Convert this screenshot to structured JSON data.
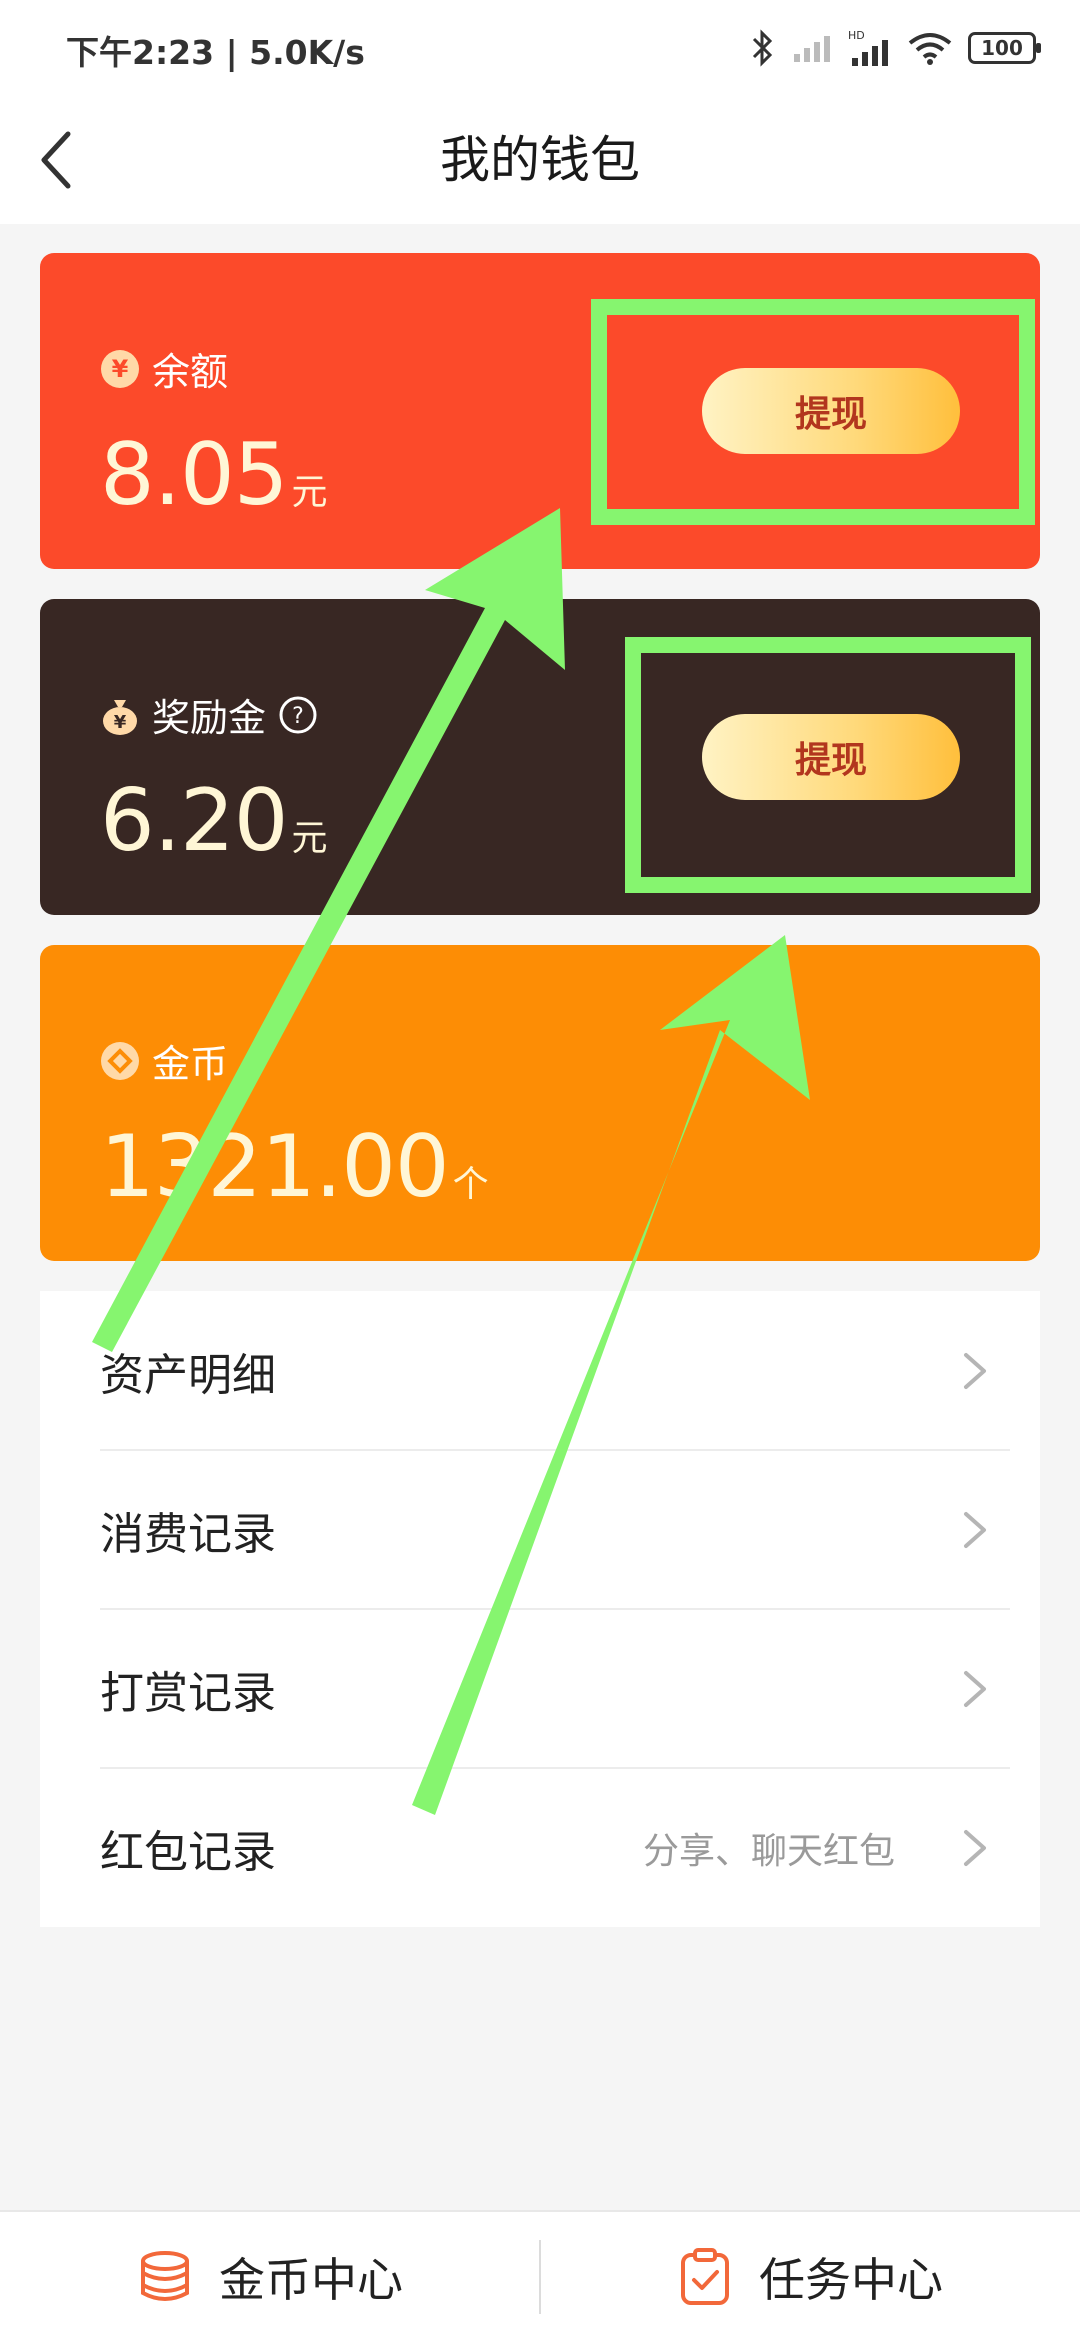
{
  "status_bar": {
    "time": "下午2:23 | 5.0K/s",
    "battery": "100",
    "network_badge": "HD"
  },
  "header": {
    "title": "我的钱包"
  },
  "cards": {
    "balance": {
      "label": "余额",
      "icon": "yen-coin-icon",
      "amount": "8.05",
      "unit": "元",
      "button_label": "提现",
      "color": "#fc4a2a"
    },
    "reward": {
      "label": "奖励金",
      "icon": "money-bag-icon",
      "amount": "6.20",
      "unit": "元",
      "button_label": "提现",
      "color": "#382723"
    },
    "coins": {
      "label": "金币",
      "icon": "coin-icon",
      "amount": "1321.00",
      "unit": "个",
      "color": "#fd8d05"
    }
  },
  "menu": {
    "items": [
      {
        "label": "资产明细",
        "sub": ""
      },
      {
        "label": "消费记录",
        "sub": ""
      },
      {
        "label": "打赏记录",
        "sub": ""
      },
      {
        "label": "红包记录",
        "sub": "分享、聊天红包"
      }
    ]
  },
  "bottom_tabs": [
    {
      "label": "金币中心",
      "icon": "coin-stack-icon"
    },
    {
      "label": "任务中心",
      "icon": "clipboard-check-icon"
    }
  ],
  "annotation_color": "#86f56f"
}
